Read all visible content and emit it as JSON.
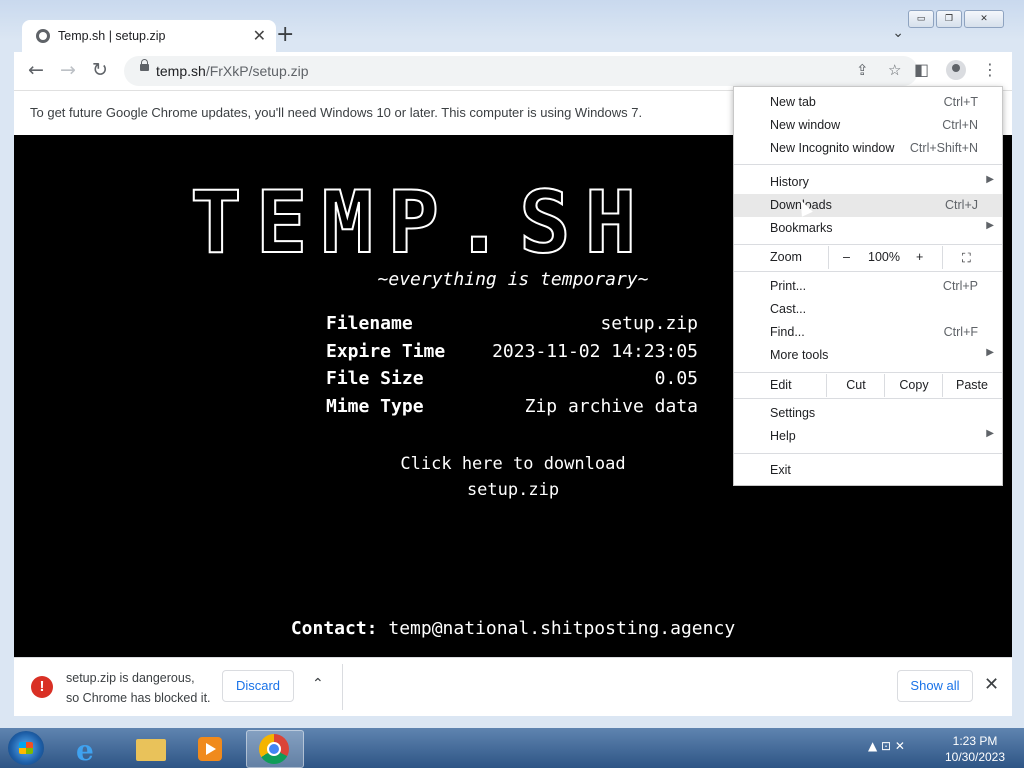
{
  "window": {
    "controls": {
      "minimize": "▭",
      "maximize": "❐",
      "close": "✕"
    }
  },
  "tab": {
    "title": "Temp.sh | setup.zip",
    "close": "✕",
    "new_tab": "+",
    "tab_search": "⌄"
  },
  "toolbar": {
    "back": "←",
    "forward": "→",
    "reload": "↻",
    "url_host": "temp.sh",
    "url_path": "/FrXkP/setup.zip",
    "share": "⇪",
    "star": "☆",
    "side_panel": "◧",
    "menu": "⋮"
  },
  "infobar": {
    "text": "To get future Google Chrome updates, you'll need Windows 10 or later. This computer is using Windows 7."
  },
  "page": {
    "logo": "TEMP.SH",
    "tagline": "~everything is temporary~",
    "info": [
      {
        "key": "Filename",
        "value": "setup.zip"
      },
      {
        "key": "Expire Time",
        "value": "2023-11-02 14:23:05"
      },
      {
        "key": "File Size",
        "value": "0.05"
      },
      {
        "key": "Mime Type",
        "value": "Zip archive data"
      }
    ],
    "download_line1": "Click here to download",
    "download_line2": "setup.zip",
    "contact_label": "Contact:",
    "contact_email": "temp@national.shitposting.agency"
  },
  "menu": {
    "new_tab": {
      "label": "New tab",
      "shortcut": "Ctrl+T"
    },
    "new_window": {
      "label": "New window",
      "shortcut": "Ctrl+N"
    },
    "incognito": {
      "label": "New Incognito window",
      "shortcut": "Ctrl+Shift+N"
    },
    "history": {
      "label": "History"
    },
    "downloads": {
      "label": "Downloads",
      "shortcut": "Ctrl+J"
    },
    "bookmarks": {
      "label": "Bookmarks"
    },
    "zoom": {
      "label": "Zoom",
      "minus": "–",
      "level": "100%",
      "plus": "+",
      "fullscreen": "⛶"
    },
    "print": {
      "label": "Print...",
      "shortcut": "Ctrl+P"
    },
    "cast": {
      "label": "Cast..."
    },
    "find": {
      "label": "Find...",
      "shortcut": "Ctrl+F"
    },
    "more_tools": {
      "label": "More tools"
    },
    "edit": {
      "label": "Edit",
      "cut": "Cut",
      "copy": "Copy",
      "paste": "Paste"
    },
    "settings": {
      "label": "Settings"
    },
    "help": {
      "label": "Help"
    },
    "exit": {
      "label": "Exit"
    },
    "arrow": "▶"
  },
  "shelf": {
    "warn_icon": "!",
    "line1": "setup.zip is dangerous,",
    "line2": "so Chrome has blocked it.",
    "discard": "Discard",
    "caret": "⌃",
    "show_all": "Show all",
    "close": "✕"
  },
  "taskbar": {
    "ie_glyph": "e",
    "tray_icons": "▲ ⊡ ✕",
    "time": "1:23 PM",
    "date": "10/30/2023"
  }
}
